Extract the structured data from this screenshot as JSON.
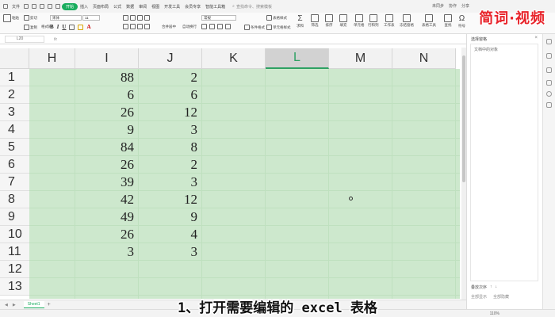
{
  "menubar": {
    "file": "文件",
    "items": [
      "开始",
      "插入",
      "页面布局",
      "公式",
      "数据",
      "审阅",
      "视图",
      "开发工具",
      "会员专享",
      "智能工具箱"
    ],
    "active_index": 0,
    "search": "查找命令、搜索模板",
    "status": [
      "未同步",
      "协作",
      "分享"
    ]
  },
  "ribbon": {
    "cut": "剪切",
    "paste": "粘贴",
    "copy": "复制",
    "format_painter": "格式刷",
    "font_name": "宋体",
    "font_size": "11",
    "number_format": "常规",
    "merge_center": "合并居中",
    "wrap_text": "自动换行",
    "table_style": "表格样式",
    "cell_style": "单元格样式",
    "conditional_format": "条件格式",
    "sum": "求和",
    "filter": "筛选",
    "sort": "排序",
    "fill": "填充",
    "cell": "单元格",
    "row_col": "行和列",
    "worksheet": "工作表",
    "freeze": "冻结窗格",
    "table_tools": "表格工具",
    "find": "查找",
    "symbol": "符号"
  },
  "watermark": "简词·视频",
  "formula_bar": {
    "cell_ref": "L20",
    "fx": "fx",
    "value": ""
  },
  "grid": {
    "columns": [
      "H",
      "I",
      "J",
      "K",
      "L",
      "M",
      "N"
    ],
    "selected_column": "L",
    "rows": [
      "1",
      "2",
      "3",
      "4",
      "5",
      "6",
      "7",
      "8",
      "9",
      "10",
      "11",
      "12",
      "13"
    ],
    "col_I": [
      "88",
      "6",
      "26",
      "9",
      "84",
      "26",
      "39",
      "42",
      "49",
      "26",
      "3"
    ],
    "col_J": [
      "2",
      "6",
      "12",
      "3",
      "8",
      "2",
      "3",
      "12",
      "9",
      "4",
      "3"
    ]
  },
  "sheet_tabs": {
    "tabs": [
      "Sheet1"
    ],
    "add": "+"
  },
  "side_pane": {
    "title": "选择窗格",
    "subtitle": "文档中的对象",
    "order_label": "叠放次序",
    "order_controls": [
      "↑",
      "↓"
    ],
    "show_all": "全部显示",
    "hide_all": "全部隐藏"
  },
  "status": {
    "zoom": "110%"
  },
  "subtitle": "1、打开需要编辑的 excel 表格",
  "colors": {
    "accent": "#1aad5e",
    "selection_fill": "#cde8cd",
    "watermark": "#e8232a"
  }
}
